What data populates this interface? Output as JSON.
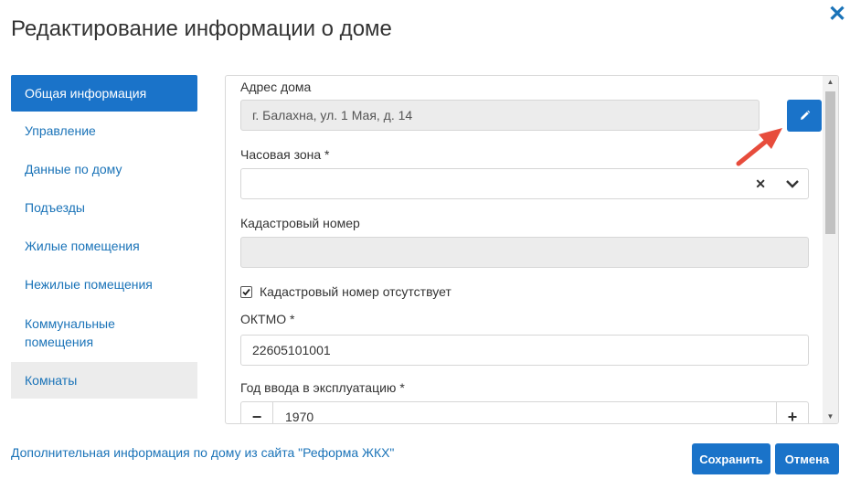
{
  "dialog": {
    "title": "Редактирование информации о доме",
    "close_icon": "close-icon"
  },
  "sidebar": {
    "items": [
      {
        "label": "Общая информация",
        "state": "active"
      },
      {
        "label": "Управление"
      },
      {
        "label": "Данные по дому"
      },
      {
        "label": "Подъезды"
      },
      {
        "label": "Жилые помещения"
      },
      {
        "label": "Нежилые помещения"
      },
      {
        "label": "Коммунальные помещения"
      },
      {
        "label": "Комнаты",
        "state": "highlighted"
      }
    ]
  },
  "form": {
    "address": {
      "label": "Адрес дома",
      "value": "г. Балахна, ул. 1 Мая, д. 14"
    },
    "timezone": {
      "label": "Часовая зона *",
      "value": ""
    },
    "cadastral": {
      "label": "Кадастровый номер",
      "value": ""
    },
    "cadastral_missing": {
      "label": "Кадастровый номер отсутствует",
      "checked": true
    },
    "oktmo": {
      "label": "ОКТМО *",
      "value": "22605101001"
    },
    "year": {
      "label": "Год ввода в эксплуатацию *",
      "value": "1970"
    }
  },
  "footer": {
    "link": "Дополнительная информация по дому из сайта \"Реформа ЖКХ\"",
    "save_label": "Сохранить",
    "cancel_label": "Отмена"
  },
  "colors": {
    "accent": "#1a73c9",
    "arrow": "#e74c3c"
  }
}
